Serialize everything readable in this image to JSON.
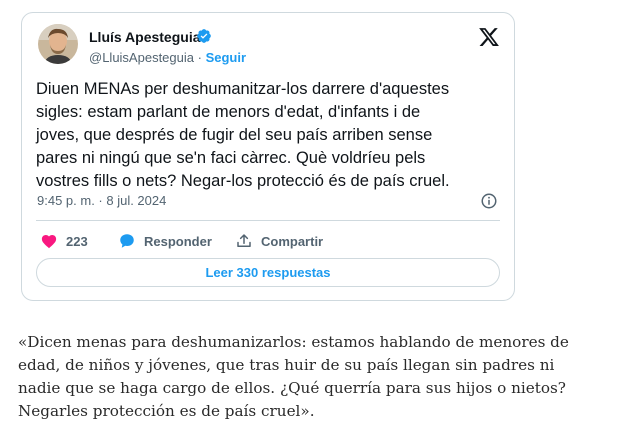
{
  "tweet": {
    "author_name": "Lluís Apesteguia",
    "handle": "@LluisApesteguia",
    "separator": "·",
    "follow_label": "Seguir",
    "text_lines": [
      "Diuen MENAs per deshumanitzar-los darrere d'aquestes",
      "sigles: estam parlant de menors d'edat, d'infants i de",
      "joves, que després de fugir del seu país arriben sense",
      "pares ni ningú que se'n faci càrrec. Què voldríeu pels",
      "vostres fills o nets? Negar-los protecció és de país cruel."
    ],
    "timestamp": "9:45 p. m. · 8 jul. 2024",
    "like_count": "223",
    "reply_label": "Responder",
    "share_label": "Compartir",
    "read_replies_label": "Leer 330 respuestas",
    "icons": {
      "avatar": "author-avatar",
      "verified": "verified-badge-icon",
      "logo": "x-logo-icon",
      "info": "info-icon",
      "like": "heart-icon",
      "reply": "reply-bubble-icon",
      "share": "share-icon"
    },
    "colors": {
      "accent": "#1d9bf0",
      "like": "#f91880",
      "muted": "#536471",
      "border": "#cfd9de"
    }
  },
  "quote": {
    "lines": [
      "«Dicen menas para deshumanizarlos: estamos hablando de menores de",
      "edad, de niños y jóvenes, que tras huir de su país llegan sin padres ni",
      "nadie que se haga cargo de ellos. ¿Qué querría para sus hijos o nietos?",
      "Negarles protección es de país cruel»."
    ]
  }
}
